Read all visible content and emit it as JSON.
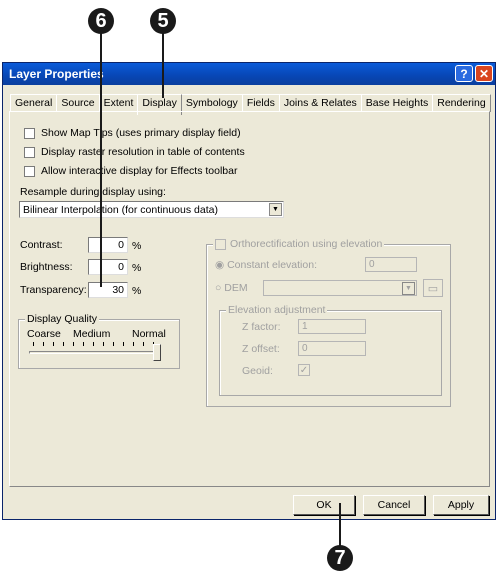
{
  "callouts": [
    "6",
    "5",
    "7"
  ],
  "window": {
    "title": "Layer Properties",
    "help_glyph": "?",
    "close_glyph": "✕"
  },
  "tabs": [
    "General",
    "Source",
    "Extent",
    "Display",
    "Symbology",
    "Fields",
    "Joins & Relates",
    "Base Heights",
    "Rendering"
  ],
  "display": {
    "show_map_tips": "Show Map Tips (uses primary display field)",
    "display_raster_resolution": "Display raster resolution in table of contents",
    "allow_interactive": "Allow interactive display for Effects toolbar",
    "resample_label": "Resample during display using:",
    "resample_value": "Bilinear Interpolation (for continuous data)",
    "contrast_label": "Contrast:",
    "contrast_value": "0",
    "brightness_label": "Brightness:",
    "brightness_value": "0",
    "transparency_label": "Transparency:",
    "transparency_value": "30",
    "percent": "%",
    "quality": {
      "title": "Display Quality",
      "coarse": "Coarse",
      "medium": "Medium",
      "normal": "Normal",
      "level": "Normal"
    }
  },
  "ortho": {
    "title": "Orthorectification using elevation",
    "constant_label": "Constant elevation:",
    "constant_value": "0",
    "dem_label": "DEM",
    "adjust": {
      "title": "Elevation adjustment",
      "z_factor_label": "Z factor:",
      "z_factor_value": "1",
      "z_offset_label": "Z offset:",
      "z_offset_value": "0",
      "geoid_label": "Geoid:"
    }
  },
  "buttons": {
    "ok": "OK",
    "cancel": "Cancel",
    "apply": "Apply"
  }
}
